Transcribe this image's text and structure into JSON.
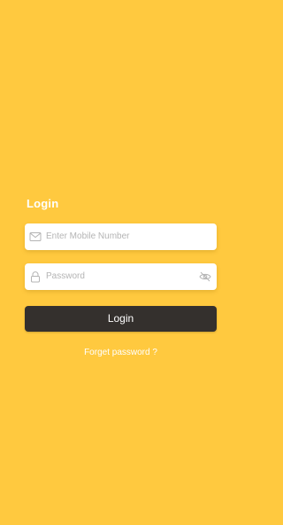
{
  "login_title": "Login",
  "email_field": {
    "placeholder": "Enter Mobile Number",
    "icon": "mail-icon"
  },
  "password_field": {
    "placeholder": "Password",
    "icon": "lock-icon",
    "toggle_icon": "eye-off-icon"
  },
  "login_button": {
    "label": "Login"
  },
  "forgot_link": "Forget password ?",
  "colors": {
    "background": "#FFC93F",
    "button": "#34302D",
    "field": "#FFFFFF",
    "placeholder": "#B4B4B4"
  }
}
